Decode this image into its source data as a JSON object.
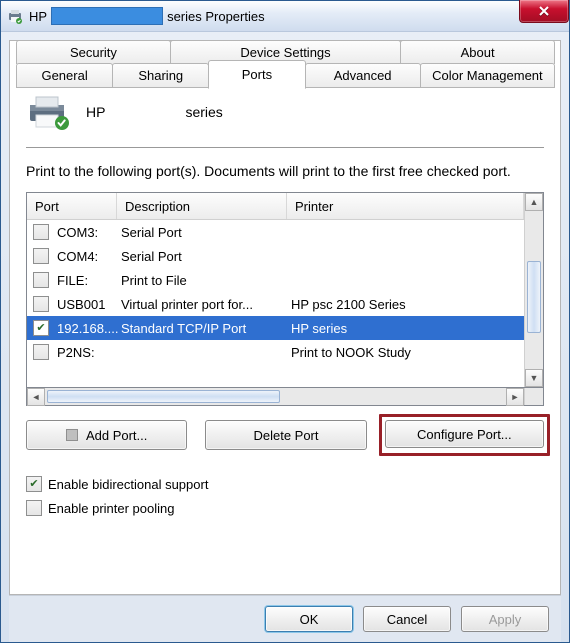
{
  "window": {
    "title_prefix": "HP",
    "title_suffix": "series Properties"
  },
  "tabs_row1": [
    {
      "label": "Security"
    },
    {
      "label": "Device Settings"
    },
    {
      "label": "About"
    }
  ],
  "tabs_row2": [
    {
      "label": "General"
    },
    {
      "label": "Sharing"
    },
    {
      "label": "Ports"
    },
    {
      "label": "Advanced"
    },
    {
      "label": "Color Management"
    }
  ],
  "header": {
    "name_prefix": "HP",
    "name_suffix": "series"
  },
  "instructions": "Print to the following port(s). Documents will print to the first free checked port.",
  "columns": {
    "port": "Port",
    "desc": "Description",
    "printer": "Printer"
  },
  "rows": [
    {
      "checked": false,
      "port": "COM3:",
      "desc": "Serial Port",
      "printer": ""
    },
    {
      "checked": false,
      "port": "COM4:",
      "desc": "Serial Port",
      "printer": ""
    },
    {
      "checked": false,
      "port": "FILE:",
      "desc": "Print to File",
      "printer": ""
    },
    {
      "checked": false,
      "port": "USB001",
      "desc": "Virtual printer port for...",
      "printer": "HP psc 2100 Series"
    },
    {
      "checked": true,
      "port": "192.168....",
      "desc": "Standard TCP/IP Port",
      "printer": "HP                               series"
    },
    {
      "checked": false,
      "port": "P2NS:",
      "desc": "",
      "printer": "Print to NOOK Study"
    }
  ],
  "buttons": {
    "add": "Add Port...",
    "delete": "Delete Port",
    "configure": "Configure Port..."
  },
  "options": {
    "bidi": {
      "label": "Enable bidirectional support",
      "checked": true
    },
    "pool": {
      "label": "Enable printer pooling",
      "checked": false
    }
  },
  "footer": {
    "ok": "OK",
    "cancel": "Cancel",
    "apply": "Apply"
  }
}
